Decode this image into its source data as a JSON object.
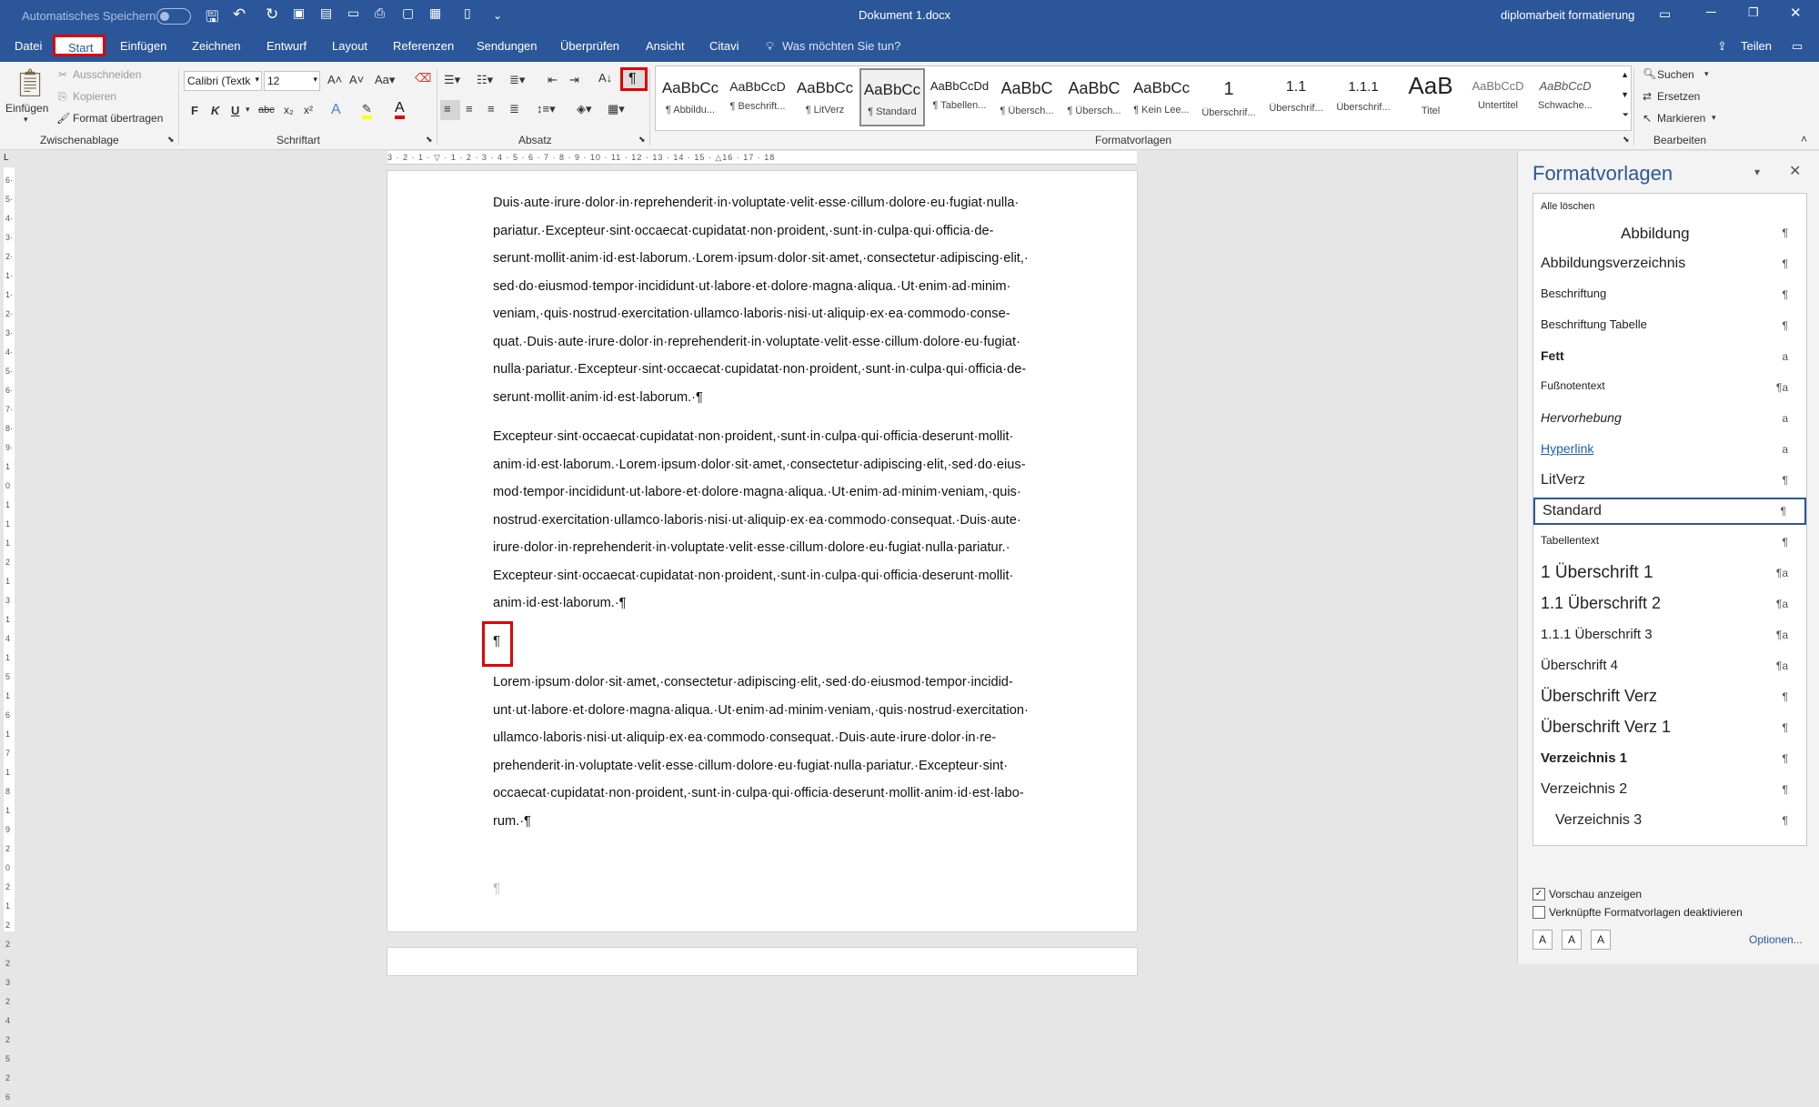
{
  "titlebar": {
    "autosave": "Automatisches Speichern",
    "doc_title": "Dokument 1.docx",
    "user": "diplomarbeit formatierung"
  },
  "tabs": [
    "Datei",
    "Start",
    "Einfügen",
    "Zeichnen",
    "Entwurf",
    "Layout",
    "Referenzen",
    "Sendungen",
    "Überprüfen",
    "Ansicht",
    "Citavi"
  ],
  "tell_me": "Was möchten Sie tun?",
  "share": "Teilen",
  "clipboard": {
    "paste": "Einfügen",
    "cut": "Ausschneiden",
    "copy": "Kopieren",
    "format_painter": "Format übertragen",
    "group": "Zwischenablage"
  },
  "font": {
    "name": "Calibri (Textk",
    "size": "12",
    "bold": "F",
    "italic": "K",
    "underline": "U",
    "strike": "abc",
    "sub": "x₂",
    "sup": "x²",
    "group": "Schriftart"
  },
  "paragraph": {
    "group": "Absatz",
    "pilcrow": "¶"
  },
  "styles_gallery": {
    "group": "Formatvorlagen",
    "tiles": [
      {
        "preview": "AaBbCc",
        "name": "¶ Abbildu..."
      },
      {
        "preview": "AaBbCcD",
        "name": "¶ Beschrift..."
      },
      {
        "preview": "AaBbCc",
        "name": "¶ LitVerz"
      },
      {
        "preview": "AaBbCc",
        "name": "¶ Standard"
      },
      {
        "preview": "AaBbCcDd",
        "name": "¶ Tabellen..."
      },
      {
        "preview": "AaBbC",
        "name": "¶ Übersch..."
      },
      {
        "preview": "AaBbC",
        "name": "¶ Übersch..."
      },
      {
        "preview": "AaBbCc",
        "name": "¶ Kein Lee..."
      },
      {
        "preview": "1",
        "name": "Überschrif..."
      },
      {
        "preview": "1.1",
        "name": "Überschrif..."
      },
      {
        "preview": "1.1.1",
        "name": "Überschrif..."
      },
      {
        "preview": "AaB",
        "name": "Titel"
      },
      {
        "preview": "AaBbCcD",
        "name": "Untertitel"
      },
      {
        "preview": "AaBbCcD",
        "name": "Schwache..."
      }
    ]
  },
  "editing": {
    "find": "Suchen",
    "replace": "Ersetzen",
    "select": "Markieren",
    "group": "Bearbeiten"
  },
  "document": {
    "p1": "Duis·aute·irure·dolor·in·reprehenderit·in·voluptate·velit·esse·cillum·dolore·eu·fugiat·nulla· pariatur.·Excepteur·sint·occaecat·cupidatat·non·proident,·sunt·in·culpa·qui·officia·de- serunt·mollit·anim·id·est·laborum.·Lorem·ipsum·dolor·sit·amet,·consectetur·adipiscing·elit,· sed·do·eiusmod·tempor·incididunt·ut·labore·et·dolore·magna·aliqua.·Ut·enim·ad·minim· veniam,·quis·nostrud·exercitation·ullamco·laboris·nisi·ut·aliquip·ex·ea·commodo·conse- quat.·Duis·aute·irure·dolor·in·reprehenderit·in·voluptate·velit·esse·cillum·dolore·eu·fugiat· nulla·pariatur.·Excepteur·sint·occaecat·cupidatat·non·proident,·sunt·in·culpa·qui·officia·de- serunt·mollit·anim·id·est·laborum.·¶",
    "p2": "Excepteur·sint·occaecat·cupidatat·non·proident,·sunt·in·culpa·qui·officia·deserunt·mollit· anim·id·est·laborum.·Lorem·ipsum·dolor·sit·amet,·consectetur·adipiscing·elit,·sed·do·eius- mod·tempor·incididunt·ut·labore·et·dolore·magna·aliqua.·Ut·enim·ad·minim·veniam,·quis· nostrud·exercitation·ullamco·laboris·nisi·ut·aliquip·ex·ea·commodo·consequat.·Duis·aute· irure·dolor·in·reprehenderit·in·voluptate·velit·esse·cillum·dolore·eu·fugiat·nulla·pariatur.· Excepteur·sint·occaecat·cupidatat·non·proident,·sunt·in·culpa·qui·officia·deserunt·mollit· anim·id·est·laborum.·¶",
    "empty_mark": "¶",
    "p3": "Lorem·ipsum·dolor·sit·amet,·consectetur·adipiscing·elit,·sed·do·eiusmod·tempor·incidid- unt·ut·labore·et·dolore·magna·aliqua.·Ut·enim·ad·minim·veniam,·quis·nostrud·exercitation· ullamco·laboris·nisi·ut·aliquip·ex·ea·commodo·consequat.·Duis·aute·irure·dolor·in·re- prehenderit·in·voluptate·velit·esse·cillum·dolore·eu·fugiat·nulla·pariatur.·Excepteur·sint· occaecat·cupidatat·non·proident,·sunt·in·culpa·qui·officia·deserunt·mollit·anim·id·est·labo- rum.·¶",
    "end_mark": "¶"
  },
  "styles_pane": {
    "title": "Formatvorlagen",
    "clear_all": "Alle löschen",
    "items": [
      {
        "name": "Abbildung",
        "mark": "¶"
      },
      {
        "name": "Abbildungsverzeichnis",
        "mark": "¶"
      },
      {
        "name": "Beschriftung",
        "mark": "¶"
      },
      {
        "name": "Beschriftung Tabelle",
        "mark": "¶"
      },
      {
        "name": "Fett",
        "mark": "a"
      },
      {
        "name": "Fußnotentext",
        "mark": "¶a"
      },
      {
        "name": "Hervorhebung",
        "mark": "a"
      },
      {
        "name": "Hyperlink",
        "mark": "a"
      },
      {
        "name": "LitVerz",
        "mark": "¶"
      },
      {
        "name": "Standard",
        "mark": "¶"
      },
      {
        "name": "Tabellentext",
        "mark": "¶"
      },
      {
        "name": "1  Überschrift 1",
        "mark": "¶a"
      },
      {
        "name": "1.1  Überschrift 2",
        "mark": "¶a"
      },
      {
        "name": "1.1.1  Überschrift 3",
        "mark": "¶a"
      },
      {
        "name": "Überschrift 4",
        "mark": "¶a"
      },
      {
        "name": "Überschrift Verz",
        "mark": "¶"
      },
      {
        "name": "Überschrift Verz 1",
        "mark": "¶"
      },
      {
        "name": "Verzeichnis 1",
        "mark": "¶"
      },
      {
        "name": "Verzeichnis 2",
        "mark": "¶"
      },
      {
        "name": "Verzeichnis 3",
        "mark": "¶"
      }
    ],
    "show_preview": "Vorschau anzeigen",
    "disable_linked": "Verknüpfte Formatvorlagen deaktivieren",
    "options": "Optionen..."
  },
  "colors": {
    "accent": "#2b579a",
    "highlight_box": "#e00000"
  }
}
